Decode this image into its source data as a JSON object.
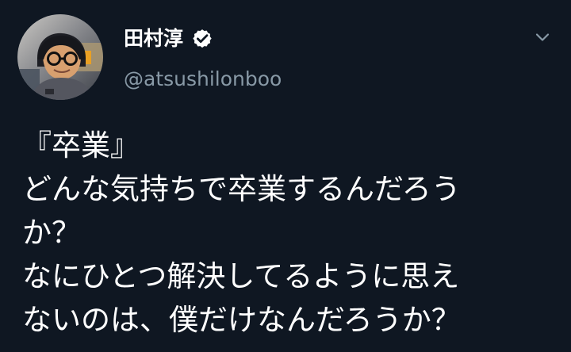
{
  "tweet": {
    "display_name": "田村淳",
    "handle": "@atsushilonboo",
    "verified": true,
    "text_lines": [
      "『卒業』",
      "どんな気持ちで卒業するんだろう",
      "か？",
      "なにひとつ解決してるように思え",
      "ないのは、僕だけなんだろうか？"
    ]
  },
  "icons": {
    "verified": "verified-badge-icon",
    "menu": "chevron-down-icon"
  },
  "colors": {
    "background": "#0f1722",
    "primary_text": "#ffffff",
    "secondary_text": "#8899a6",
    "verified_badge": "#ffffff",
    "chevron": "#8899a6"
  }
}
